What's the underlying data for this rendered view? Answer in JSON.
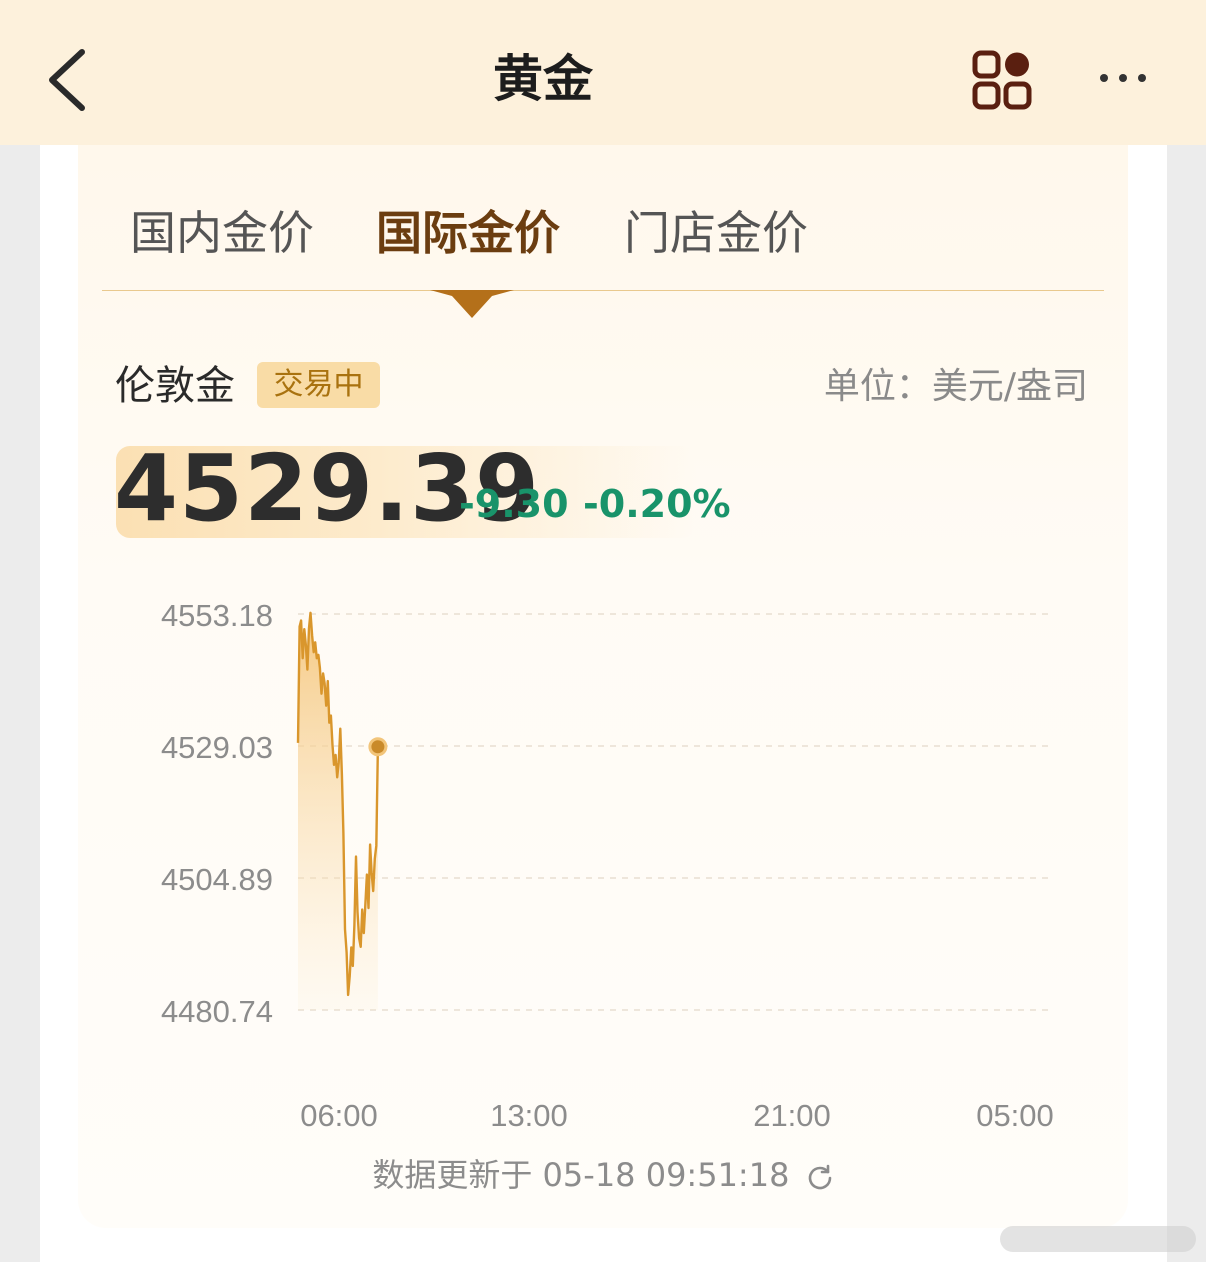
{
  "header": {
    "title": "黄金"
  },
  "tabs": [
    {
      "label": "国内金价",
      "active": false
    },
    {
      "label": "国际金价",
      "active": true
    },
    {
      "label": "门店金价",
      "active": false
    }
  ],
  "quote": {
    "name": "伦敦金",
    "status": "交易中",
    "unit_label": "单位：",
    "unit_value": "美元/盎司",
    "price": "4529.39",
    "change": "-9.30",
    "change_pct": "-0.20%",
    "change_color": "#19936a"
  },
  "chart_data": {
    "type": "area",
    "y_ticks": [
      "4553.18",
      "4529.03",
      "4504.89",
      "4480.74"
    ],
    "ylim": [
      4480.74,
      4553.18
    ],
    "x_ticks": [
      "06:00",
      "13:00",
      "21:00",
      "05:00"
    ],
    "series": [
      {
        "color": "#d9962c",
        "points": [
          [
            "05:00",
            4529.6
          ],
          [
            "05:03",
            4550.9
          ],
          [
            "05:06",
            4552.0
          ],
          [
            "05:09",
            4545.1
          ],
          [
            "05:12",
            4550.4
          ],
          [
            "05:15",
            4547.6
          ],
          [
            "05:18",
            4543.0
          ],
          [
            "05:21",
            4550.6
          ],
          [
            "05:24",
            4553.4
          ],
          [
            "05:27",
            4549.3
          ],
          [
            "05:30",
            4546.2
          ],
          [
            "05:33",
            4548.0
          ],
          [
            "05:36",
            4545.1
          ],
          [
            "05:39",
            4545.7
          ],
          [
            "05:42",
            4543.3
          ],
          [
            "05:45",
            4538.6
          ],
          [
            "05:48",
            4542.3
          ],
          [
            "05:51",
            4540.5
          ],
          [
            "05:54",
            4536.4
          ],
          [
            "05:57",
            4540.9
          ],
          [
            "06:00",
            4533.3
          ],
          [
            "06:03",
            4534.6
          ],
          [
            "06:06",
            4529.2
          ],
          [
            "06:09",
            4525.6
          ],
          [
            "06:12",
            4527.4
          ],
          [
            "06:15",
            4523.3
          ],
          [
            "06:18",
            4526.0
          ],
          [
            "06:21",
            4532.2
          ],
          [
            "06:24",
            4523.8
          ],
          [
            "06:27",
            4513.1
          ],
          [
            "06:30",
            4495.5
          ],
          [
            "06:33",
            4491.3
          ],
          [
            "06:36",
            4483.5
          ],
          [
            "06:39",
            4486.9
          ],
          [
            "06:42",
            4492.2
          ],
          [
            "06:45",
            4488.8
          ],
          [
            "06:48",
            4496.3
          ],
          [
            "06:51",
            4508.8
          ],
          [
            "06:54",
            4498.7
          ],
          [
            "06:57",
            4493.9
          ],
          [
            "07:00",
            4492.3
          ],
          [
            "07:03",
            4499.1
          ],
          [
            "07:06",
            4494.8
          ],
          [
            "07:09",
            4500.2
          ],
          [
            "07:12",
            4505.5
          ],
          [
            "07:15",
            4499.4
          ],
          [
            "07:18",
            4511.0
          ],
          [
            "07:21",
            4505.9
          ],
          [
            "07:24",
            4502.5
          ],
          [
            "07:27",
            4508.4
          ],
          [
            "07:30",
            4510.8
          ],
          [
            "07:33",
            4528.9
          ]
        ],
        "last_value": 4529.39
      }
    ],
    "grid": true,
    "gridline_style": "dashed"
  },
  "footer": {
    "update_text": "数据更新于 05-18 09:51:18"
  }
}
